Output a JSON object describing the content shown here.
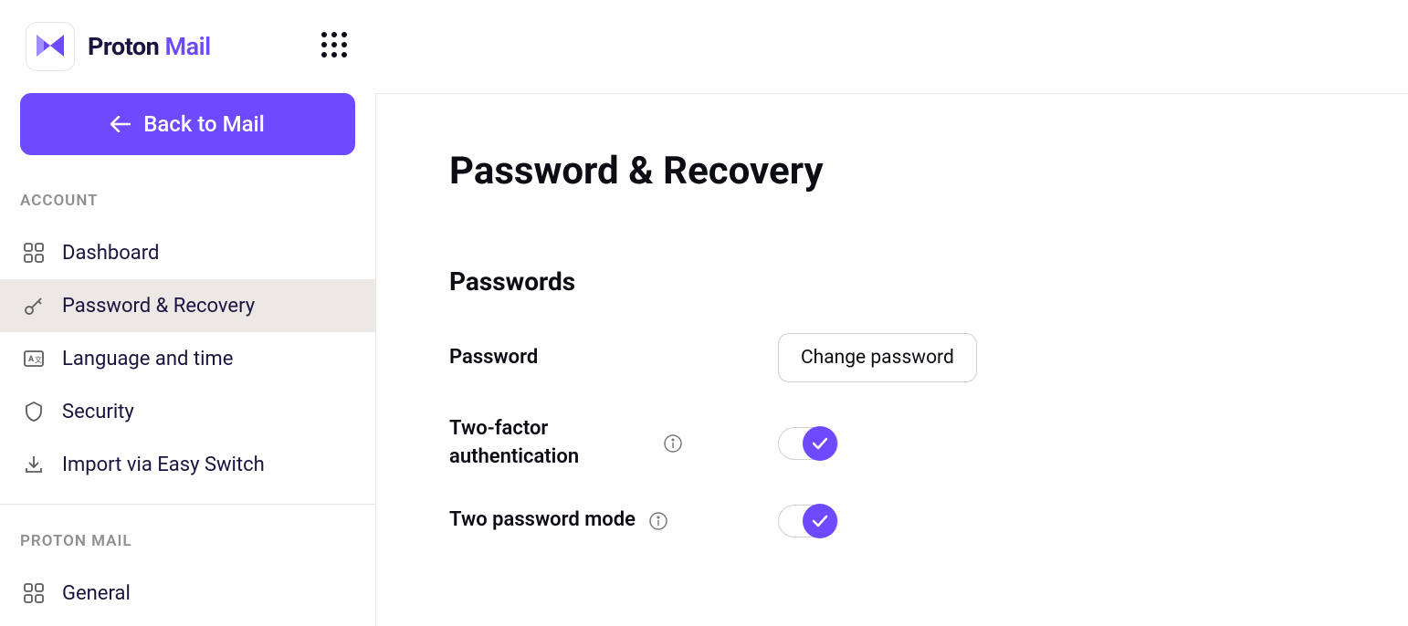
{
  "brand": {
    "name1": "Proton",
    "name2": "Mail"
  },
  "backButton": "Back to Mail",
  "sidebar": {
    "section1": "ACCOUNT",
    "section2": "PROTON MAIL",
    "items": {
      "dashboard": "Dashboard",
      "passwordRecovery": "Password & Recovery",
      "languageTime": "Language and time",
      "security": "Security",
      "importEasySwitch": "Import via Easy Switch",
      "general": "General"
    }
  },
  "content": {
    "title": "Password & Recovery",
    "sectionTitle": "Passwords",
    "passwordLabel": "Password",
    "changePasswordBtn": "Change password",
    "twoFactorLabel": "Two-factor authentication",
    "twoPasswordLabel": "Two password mode"
  }
}
